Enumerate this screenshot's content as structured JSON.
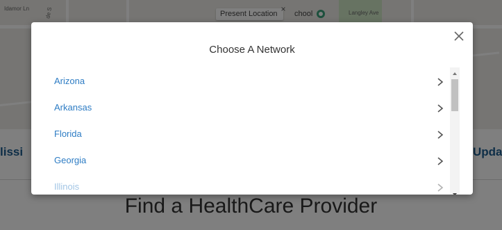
{
  "background": {
    "map": {
      "present_location": "Present Location",
      "school_label": "chool",
      "street_labels": [
        "Langley Ave",
        "Idamor Ln",
        "de S"
      ]
    },
    "side_left_text": "lissi",
    "side_right_text": "Upda",
    "heading": "Find a HealthCare Provider"
  },
  "modal": {
    "title": "Choose A Network",
    "close_icon": "close-icon",
    "items": [
      {
        "label": "Arizona"
      },
      {
        "label": "Arkansas"
      },
      {
        "label": "Florida"
      },
      {
        "label": "Georgia"
      },
      {
        "label": "Illinois"
      }
    ],
    "chevron_icon": "chevron-right-icon"
  },
  "colors": {
    "overlay": "rgba(0,0,0,0.5)",
    "link": "#2d7cc4",
    "side_text": "#1d5d8f"
  }
}
